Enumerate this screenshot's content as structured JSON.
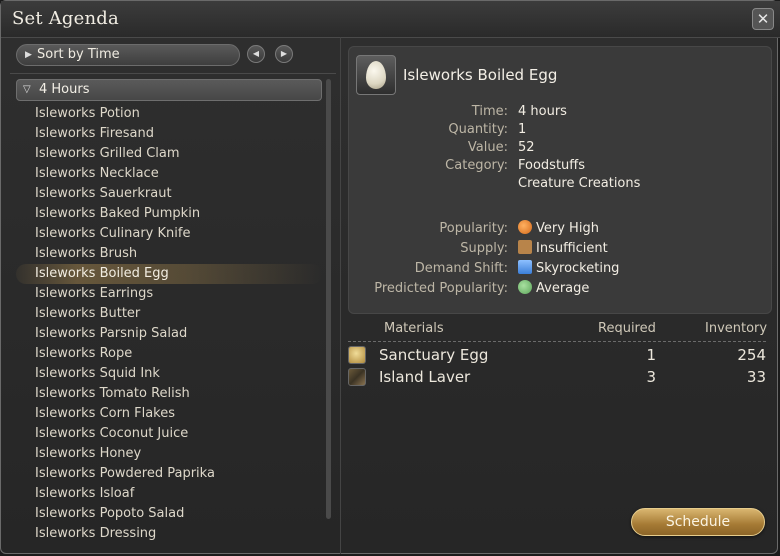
{
  "window": {
    "title": "Set Agenda",
    "close_icon": "close-icon"
  },
  "left": {
    "sort_label": "Sort by Time",
    "group_label": "4 Hours",
    "items": [
      "Isleworks Potion",
      "Isleworks Firesand",
      "Isleworks Grilled Clam",
      "Isleworks Necklace",
      "Isleworks Sauerkraut",
      "Isleworks Baked Pumpkin",
      "Isleworks Culinary Knife",
      "Isleworks Brush",
      "Isleworks Boiled Egg",
      "Isleworks Earrings",
      "Isleworks Butter",
      "Isleworks Parsnip Salad",
      "Isleworks Rope",
      "Isleworks Squid Ink",
      "Isleworks Tomato Relish",
      "Isleworks Corn Flakes",
      "Isleworks Coconut Juice",
      "Isleworks Honey",
      "Isleworks Powdered Paprika",
      "Isleworks Isloaf",
      "Isleworks Popoto Salad",
      "Isleworks Dressing"
    ],
    "selected_index": 8
  },
  "detail": {
    "name": "Isleworks Boiled Egg",
    "time_label": "Time:",
    "time": "4 hours",
    "quantity_label": "Quantity:",
    "quantity": "1",
    "value_label": "Value:",
    "value": "52",
    "category_label": "Category:",
    "category_1": "Foodstuffs",
    "category_2": "Creature Creations",
    "popularity_label": "Popularity:",
    "popularity": "Very High",
    "supply_label": "Supply:",
    "supply": "Insufficient",
    "demand_label": "Demand Shift:",
    "demand": "Skyrocketing",
    "predicted_label": "Predicted Popularity:",
    "predicted": "Average"
  },
  "materials": {
    "headers": {
      "name": "Materials",
      "required": "Required",
      "inventory": "Inventory"
    },
    "rows": [
      {
        "name": "Sanctuary Egg",
        "required": "1",
        "inventory": "254"
      },
      {
        "name": "Island Laver",
        "required": "3",
        "inventory": "33"
      }
    ]
  },
  "actions": {
    "schedule": "Schedule"
  },
  "colors": {
    "accent": "#c9a45c",
    "panel": "#3a3a3a",
    "background": "#2a2a2a"
  }
}
